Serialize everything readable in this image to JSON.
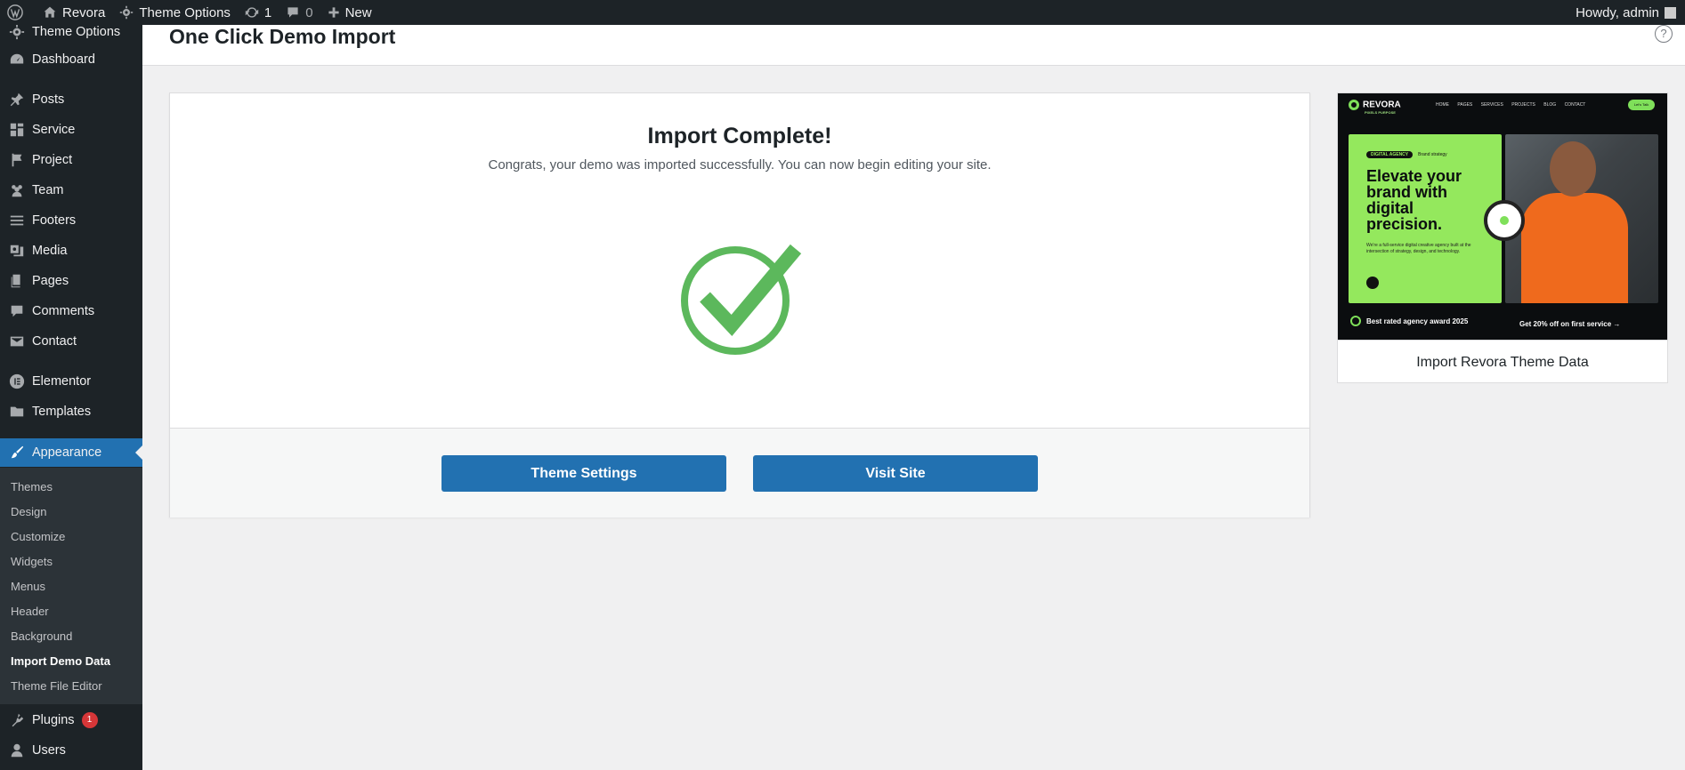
{
  "adminbar": {
    "site_name": "Revora",
    "theme_options": "Theme Options",
    "updates_count": "1",
    "comments_count": "0",
    "new_label": "New",
    "howdy": "Howdy, admin"
  },
  "sidebar": {
    "items": [
      {
        "label": "Theme Options",
        "icon": "gear-icon"
      },
      {
        "label": "Dashboard",
        "icon": "dashboard-icon"
      },
      {
        "label": "Posts",
        "icon": "pin-icon"
      },
      {
        "label": "Service",
        "icon": "grid-icon"
      },
      {
        "label": "Project",
        "icon": "flag-icon"
      },
      {
        "label": "Team",
        "icon": "team-icon"
      },
      {
        "label": "Footers",
        "icon": "list-icon"
      },
      {
        "label": "Media",
        "icon": "media-icon"
      },
      {
        "label": "Pages",
        "icon": "pages-icon"
      },
      {
        "label": "Comments",
        "icon": "comment-icon"
      },
      {
        "label": "Contact",
        "icon": "mail-icon"
      },
      {
        "label": "Elementor",
        "icon": "elementor-icon"
      },
      {
        "label": "Templates",
        "icon": "folder-icon"
      },
      {
        "label": "Appearance",
        "icon": "paintbrush-icon"
      },
      {
        "label": "Plugins",
        "icon": "plugin-icon",
        "badge": "1"
      },
      {
        "label": "Users",
        "icon": "user-icon"
      }
    ],
    "submenu": [
      "Themes",
      "Design",
      "Customize",
      "Widgets",
      "Menus",
      "Header",
      "Background",
      "Import Demo Data",
      "Theme File Editor"
    ],
    "current_submenu": "Import Demo Data"
  },
  "page": {
    "title": "One Click Demo Import",
    "help": "?"
  },
  "card": {
    "title": "Import Complete!",
    "subtitle": "Congrats, your demo was imported successfully. You can now begin editing your site.",
    "check_color": "#5cb85c",
    "buttons": {
      "theme_settings": "Theme Settings",
      "visit_site": "Visit Site"
    }
  },
  "preview": {
    "label": "Import Revora Theme Data",
    "logo": "REVORA",
    "logo_sub": "PIXELS PURPOSE",
    "menu": "HOME PAGES SERVICES PROJECTS BLOG CONTACT",
    "cta": "Let's Talk",
    "tag": "DIGITAL AGENCY",
    "tag2": "Brand strategy",
    "headline": "Elevate your brand with digital precision.",
    "para": "We're a full-service digital creative agency built at the intersection of strategy, design, and technology.",
    "award": "Best rated agency award 2025",
    "offer": "Get 20% off on first service →"
  },
  "colors": {
    "accent": "#2271b1",
    "admin_dark": "#1d2327",
    "success": "#5cb85c",
    "brand_green": "#94e85d"
  }
}
